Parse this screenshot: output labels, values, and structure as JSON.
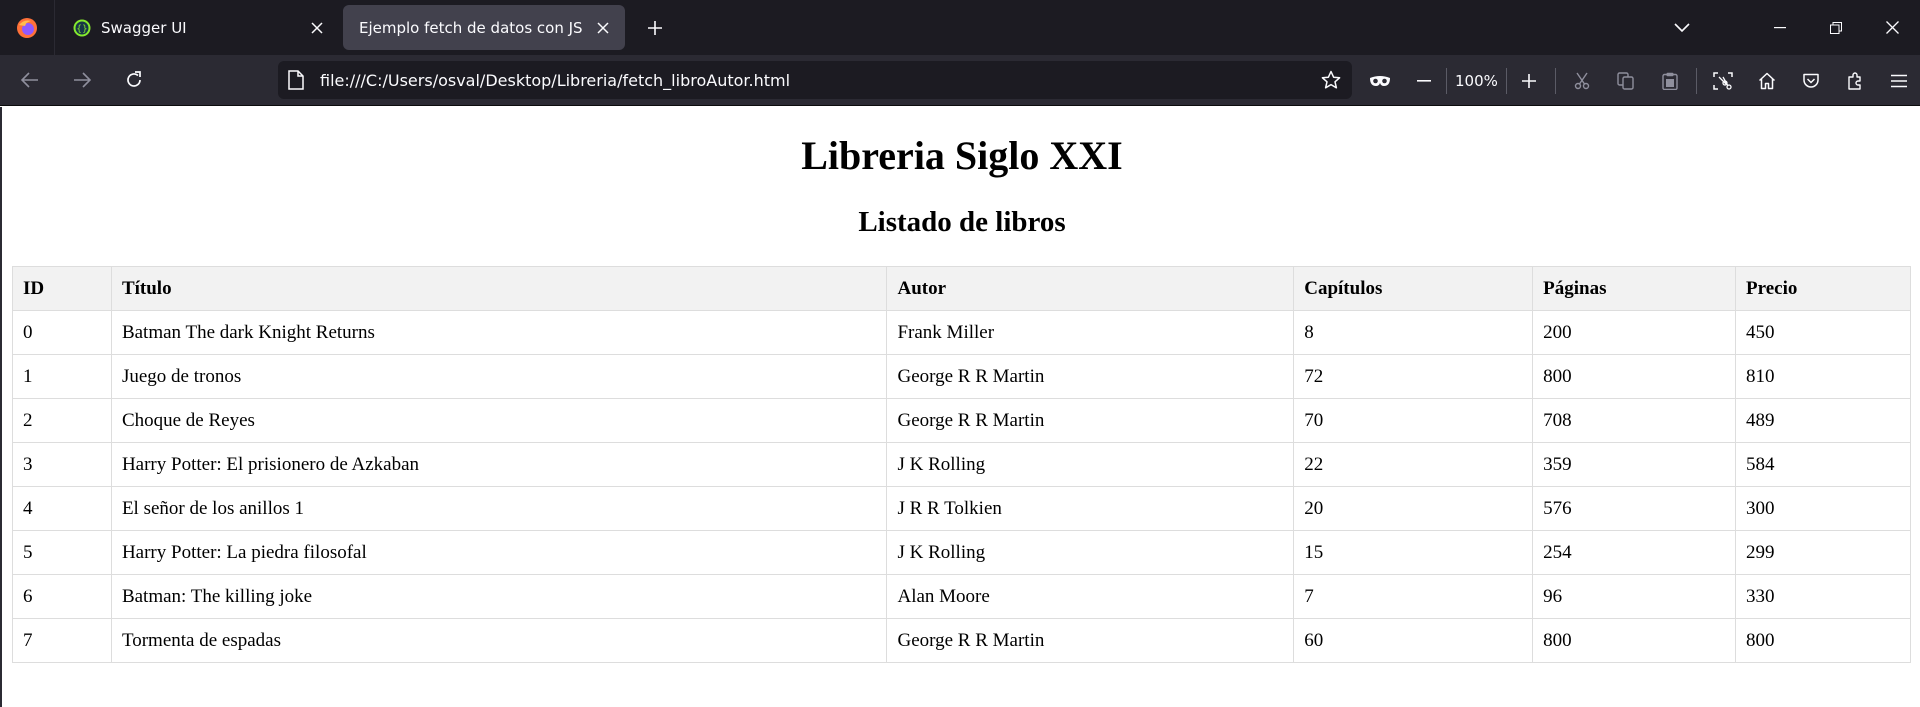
{
  "browser": {
    "tabs": [
      {
        "title": "Swagger UI",
        "active": false
      },
      {
        "title": "Ejemplo fetch de datos con JS",
        "active": true
      }
    ],
    "url": "file:///C:/Users/osval/Desktop/Libreria/fetch_libroAutor.html",
    "zoom": "100%"
  },
  "page": {
    "title": "Libreria Siglo XXI",
    "subtitle": "Listado de libros",
    "table": {
      "headers": [
        "ID",
        "Título",
        "Autor",
        "Capítulos",
        "Páginas",
        "Precio"
      ],
      "rows": [
        [
          "0",
          "Batman The dark Knight Returns",
          "Frank Miller",
          "8",
          "200",
          "450"
        ],
        [
          "1",
          "Juego de tronos",
          "George R R Martin",
          "72",
          "800",
          "810"
        ],
        [
          "2",
          "Choque de Reyes",
          "George R R Martin",
          "70",
          "708",
          "489"
        ],
        [
          "3",
          "Harry Potter: El prisionero de Azkaban",
          "J K Rolling",
          "22",
          "359",
          "584"
        ],
        [
          "4",
          "El señor de los anillos 1",
          "J R R Tolkien",
          "20",
          "576",
          "300"
        ],
        [
          "5",
          "Harry Potter: La piedra filosofal",
          "J K Rolling",
          "15",
          "254",
          "299"
        ],
        [
          "6",
          "Batman: The killing joke",
          "Alan Moore",
          "7",
          "96",
          "330"
        ],
        [
          "7",
          "Tormenta de espadas",
          "George R R Martin",
          "60",
          "800",
          "800"
        ]
      ]
    }
  }
}
